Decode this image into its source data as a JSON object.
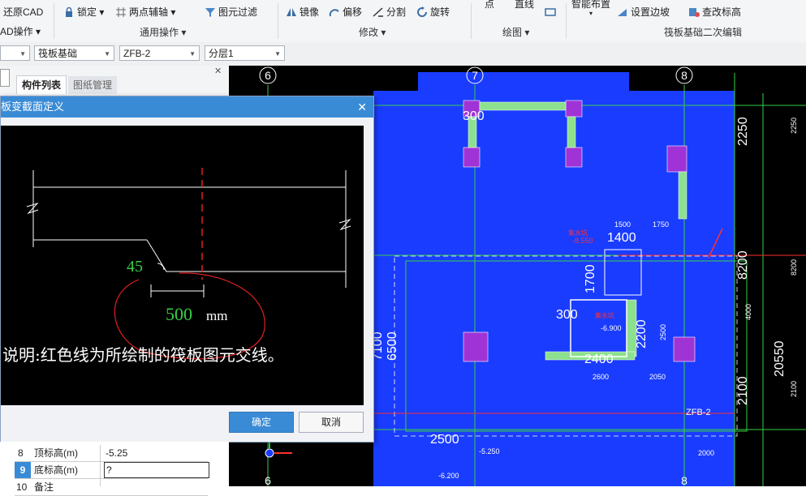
{
  "ribbon": {
    "restore_cad": "还原CAD",
    "cad_ops": "AD操作",
    "lock": "锁定",
    "two_point_axis": "两点辅轴",
    "element_filter": "图元过滤",
    "common_ops": "通用操作",
    "mirror": "镜像",
    "offset": "偏移",
    "split": "分割",
    "rotate": "旋转",
    "modify": "修改",
    "point": "点",
    "line": "直线",
    "draw": "绘图",
    "smart_layout": "智能布置",
    "set_slope_edge": "设置边坡",
    "view_elevation": "查改标高",
    "raft_edit": "筏板基础二次编辑"
  },
  "toolbar": {
    "dropdown1": "",
    "category": "筏板基础",
    "element": "ZFB-2",
    "layer": "分层1"
  },
  "left_panel": {
    "tab_components": "构件列表",
    "tab_drawings": "图纸管理"
  },
  "dialog": {
    "title": "板变截面定义",
    "angle": "45",
    "dim_value": "500",
    "dim_unit": "mm",
    "note": "说明:红色线为所绘制的筏板图元交线。",
    "ok": "确定",
    "cancel": "取消"
  },
  "properties": [
    {
      "num": "8",
      "name": "顶标高(m)",
      "value": "-5.25"
    },
    {
      "num": "9",
      "name": "底标高(m)",
      "value": "?"
    },
    {
      "num": "10",
      "name": "备注",
      "value": ""
    }
  ],
  "cad": {
    "axis_6": "6",
    "axis_7": "7",
    "axis_8": "8",
    "dim_2250": "2250",
    "dim_8200": "8200",
    "dim_20550": "20550",
    "dim_2100": "2100",
    "dim_7100": "7100",
    "dim_6500": "6500",
    "dim_2500": "2500",
    "dim_1400": "1400",
    "dim_1700": "1700",
    "dim_2200": "2200",
    "dim_300": "300",
    "dim_300b": "300",
    "dim_2400": "2400",
    "lvl_5250": "-5.250",
    "lvl_6200": "-6.200",
    "lvl_8550": "-8.550",
    "lvl_6900": "-6.900",
    "small_1500": "1500",
    "small_1750": "1750",
    "small_2600": "2600",
    "small_2050": "2050",
    "small_2000": "2000",
    "small_4000": "4000",
    "small_2500": "2500",
    "zfb_label": "ZFB-2",
    "red_note": "集水坑"
  },
  "colors": {
    "accent": "#3a8bd6",
    "slab_blue": "#1a3cff",
    "dim_green": "#36d046",
    "pink": "#c24aff"
  }
}
